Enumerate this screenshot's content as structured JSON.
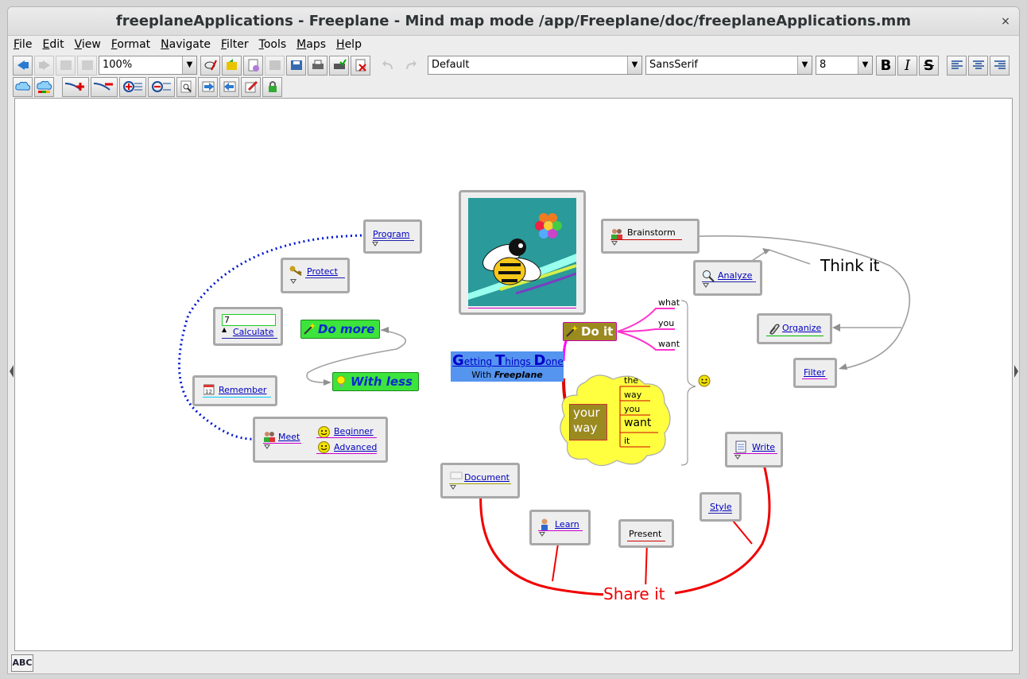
{
  "window": {
    "title": "freeplaneApplications - Freeplane - Mind map mode /app/Freeplane/doc/freeplaneApplications.mm",
    "close": "×"
  },
  "menu": [
    "File",
    "Edit",
    "View",
    "Format",
    "Navigate",
    "Filter",
    "Tools",
    "Maps",
    "Help"
  ],
  "toolbar": {
    "zoom": "100%",
    "style": "Default",
    "font": "SansSerif",
    "font_size": "8",
    "bold": "B",
    "italic": "I",
    "strike": "S"
  },
  "map": {
    "root": {
      "title_big": "G",
      "title1": "etting ",
      "title_big2": "T",
      "title2": "hings ",
      "title_big3": "D",
      "title3": "one",
      "subtitle_prefix": "With ",
      "subtitle_app": "Freeplane"
    },
    "left_nodes": {
      "program": "Program",
      "protect": "Protect",
      "calc_value": "7",
      "calculate": "Calculate",
      "remember": "Remember",
      "meet": "Meet",
      "beginner": "Beginner",
      "advanced": "Advanced",
      "do_more": "Do more",
      "with_less": "With less"
    },
    "right_nodes": {
      "brainstorm": "Brainstorm",
      "analyze": "Analyze",
      "organize": "Organize",
      "filter": "Filter",
      "think_it": "Think it",
      "do_it": "Do it",
      "what": "what",
      "you1": "you",
      "want1": "want",
      "your_way": "your\nway",
      "the": "the",
      "way": "way",
      "you2": "you",
      "want2": "want",
      "it": "it",
      "write": "Write",
      "style": "Style",
      "document": "Document",
      "learn": "Learn",
      "present": "Present",
      "share_it": "Share it"
    }
  },
  "status": {
    "spell": "ABC"
  }
}
